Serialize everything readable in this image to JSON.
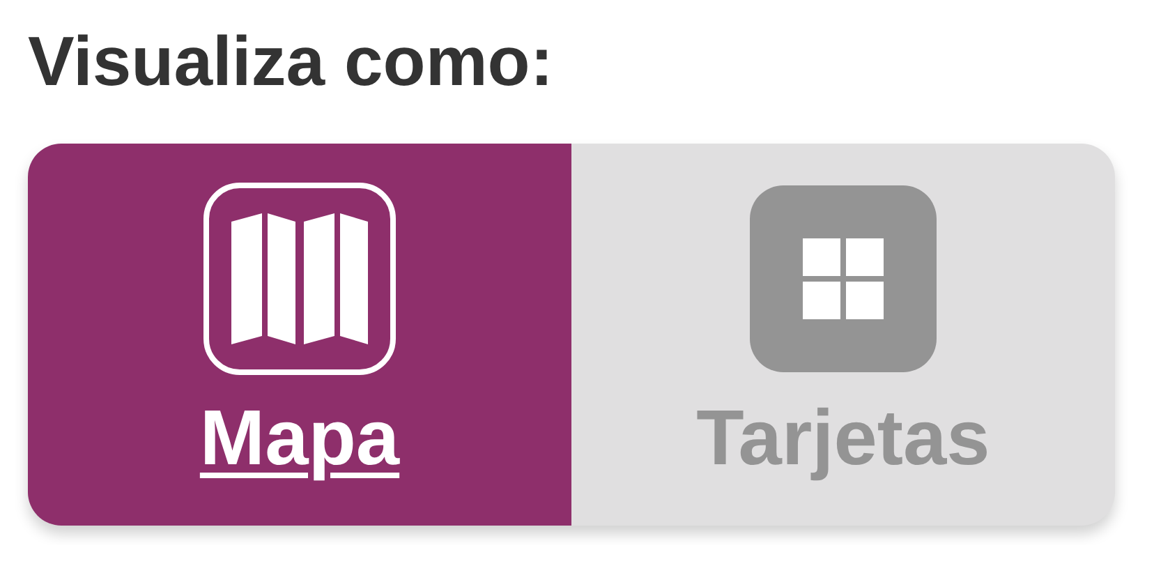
{
  "title": "Visualiza como:",
  "options": [
    {
      "label": "Mapa",
      "kind": "map",
      "selected": true
    },
    {
      "label": "Tarjetas",
      "kind": "cards",
      "selected": false
    }
  ]
}
